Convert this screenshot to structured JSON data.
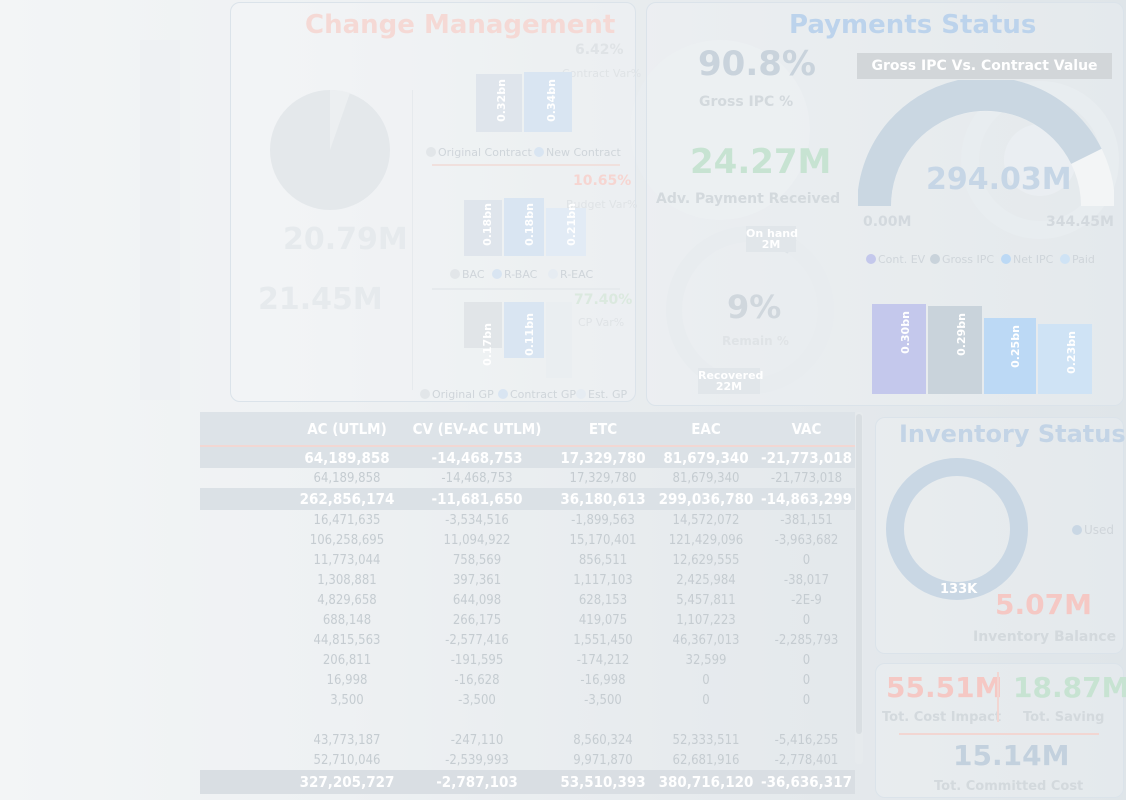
{
  "change_mgmt": {
    "title": "Change Management",
    "contract_var_pct": "6.42%",
    "contract_var_label": "Contract Var%",
    "budget_var_pct": "10.65%",
    "budget_var_label": "Budget Var%",
    "cp_var_pct": "77.40%",
    "cp_var_label": "CP Var%",
    "bar1": [
      "0.32bn",
      "0.34bn"
    ],
    "bar2": [
      "0.18bn",
      "0.18bn",
      "0.21bn"
    ],
    "bar3": [
      "0.17bn",
      "0.11bn"
    ],
    "legend1": [
      "Original Contract",
      "New Contract"
    ],
    "legend2": [
      "BAC",
      "R-BAC",
      "R-EAC"
    ],
    "legend3": [
      "Original GP",
      "Contract GP",
      "Est. GP"
    ],
    "left_num1": "20.79M",
    "left_num2": "21.45M"
  },
  "payments": {
    "title": "Payments Status",
    "gross_ipc_pct": "90.8%",
    "gross_ipc_label": "Gross IPC %",
    "adv_payment": "24.27M",
    "adv_payment_label": "Adv. Payment Received",
    "remain_pct": "9%",
    "remain_label": "Remain %",
    "on_hand_label": "On hand",
    "on_hand_value": "2M",
    "recovered_label": "Recovered",
    "recovered_value": "22M",
    "gauge_title": "Gross IPC Vs. Contract Value",
    "gauge_value": "294.03M",
    "gauge_min": "0.00M",
    "gauge_max": "344.45M",
    "legend": [
      "Cont. EV",
      "Gross IPC",
      "Net IPC",
      "Paid"
    ],
    "bars": [
      "0.30bn",
      "0.29bn",
      "0.25bn",
      "0.23bn"
    ],
    "colors": {
      "cont_ev": "#c4c8ec",
      "gross_ipc": "#c9d3db",
      "net_ipc": "#bcd9f5",
      "paid": "#cfe3f5"
    }
  },
  "table": {
    "headers": [
      "",
      "AC (UTLM)",
      "CV (EV-AC UTLM)",
      "ETC",
      "EAC",
      "VAC"
    ],
    "rows": [
      {
        "type": "sub",
        "cells": [
          "",
          "64,189,858",
          "-14,468,753",
          "17,329,780",
          "81,679,340",
          "-21,773,018"
        ]
      },
      {
        "type": "row",
        "cells": [
          "",
          "64,189,858",
          "-14,468,753",
          "17,329,780",
          "81,679,340",
          "-21,773,018"
        ]
      },
      {
        "type": "sub",
        "cells": [
          "",
          "262,856,174",
          "-11,681,650",
          "36,180,613",
          "299,036,780",
          "-14,863,299"
        ]
      },
      {
        "type": "row",
        "cells": [
          "",
          "16,471,635",
          "-3,534,516",
          "-1,899,563",
          "14,572,072",
          "-381,151"
        ]
      },
      {
        "type": "row",
        "cells": [
          "",
          "106,258,695",
          "11,094,922",
          "15,170,401",
          "121,429,096",
          "-3,963,682"
        ]
      },
      {
        "type": "row",
        "cells": [
          "",
          "11,773,044",
          "758,569",
          "856,511",
          "12,629,555",
          "0"
        ]
      },
      {
        "type": "row",
        "cells": [
          "",
          "1,308,881",
          "397,361",
          "1,117,103",
          "2,425,984",
          "-38,017"
        ]
      },
      {
        "type": "row",
        "cells": [
          "",
          "4,829,658",
          "644,098",
          "628,153",
          "5,457,811",
          "-2E-9"
        ]
      },
      {
        "type": "row",
        "cells": [
          "",
          "688,148",
          "266,175",
          "419,075",
          "1,107,223",
          "0"
        ]
      },
      {
        "type": "row",
        "cells": [
          "",
          "44,815,563",
          "-2,577,416",
          "1,551,450",
          "46,367,013",
          "-2,285,793"
        ]
      },
      {
        "type": "row",
        "cells": [
          "",
          "206,811",
          "-191,595",
          "-174,212",
          "32,599",
          "0"
        ]
      },
      {
        "type": "row",
        "cells": [
          "",
          "16,998",
          "-16,628",
          "-16,998",
          "0",
          "0"
        ]
      },
      {
        "type": "row",
        "cells": [
          "",
          "3,500",
          "-3,500",
          "-3,500",
          "0",
          "0"
        ]
      },
      {
        "type": "blank",
        "cells": [
          "",
          "",
          "",
          "",
          "",
          ""
        ]
      },
      {
        "type": "row",
        "cells": [
          "",
          "43,773,187",
          "-247,110",
          "8,560,324",
          "52,333,511",
          "-5,416,255"
        ]
      },
      {
        "type": "row",
        "cells": [
          "",
          "52,710,046",
          "-2,539,993",
          "9,971,870",
          "62,681,916",
          "-2,778,401"
        ]
      },
      {
        "type": "total",
        "cells": [
          "",
          "327,205,727",
          "-2,787,103",
          "53,510,393",
          "380,716,120",
          "-36,636,317"
        ]
      }
    ]
  },
  "inventory": {
    "title": "Inventory Status",
    "donut_label": "133K",
    "legend": "Used",
    "balance": "5.07M",
    "balance_label": "Inventory Balance"
  },
  "cost": {
    "impact": "55.51M",
    "impact_label": "Tot. Cost Impact",
    "saving": "18.87M",
    "saving_label": "Tot. Saving",
    "committed": "15.14M",
    "committed_label": "Tot. Committed Cost"
  },
  "colors": {
    "title_blue": "#bcd3ec",
    "title_red": "#f3cfcb",
    "value_green": "#c7e3d2",
    "value_red": "#f5c8c4",
    "value_blue": "#c3d1de"
  }
}
